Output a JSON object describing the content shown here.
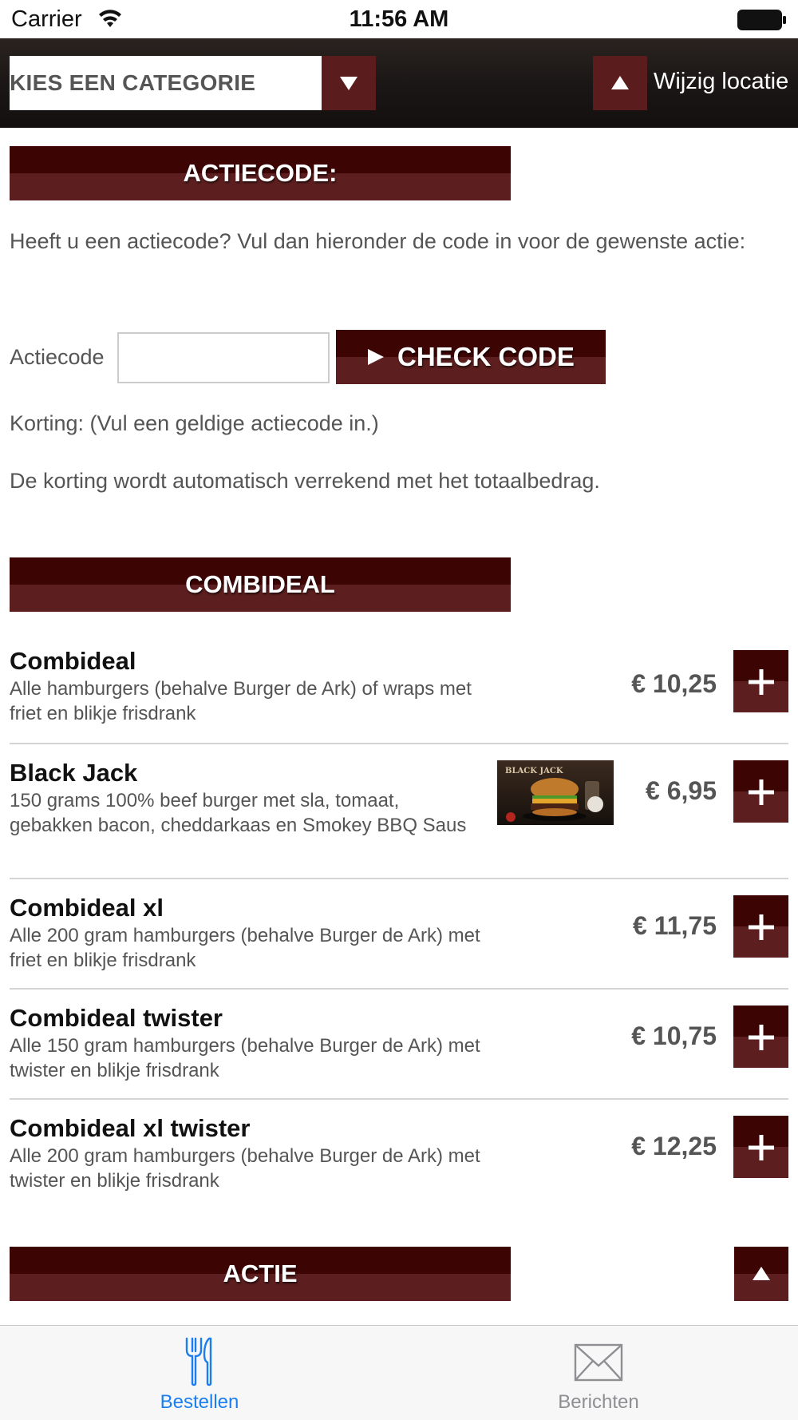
{
  "status_bar": {
    "carrier": "Carrier",
    "time": "11:56 AM"
  },
  "nav": {
    "category_select": "KIES EEN CATEGORIE",
    "location_button": "Wijzig locatie"
  },
  "promo": {
    "header": "ACTIECODE:",
    "intro": "Heeft u een actiecode? Vul dan hieronder de code in voor de gewenste actie:",
    "code_label": "Actiecode",
    "code_value": "",
    "check_button": "CHECK CODE",
    "discount_text": "Korting: (Vul een geldige actiecode in.)",
    "info_text": "De korting wordt automatisch verrekend met het totaalbedrag."
  },
  "combideal": {
    "header": "COMBIDEAL",
    "products": [
      {
        "name": "Combideal",
        "desc": "Alle hamburgers (behalve Burger de Ark) of wraps met friet en blikje frisdrank",
        "price": "€ 10,25"
      },
      {
        "name": "Black Jack",
        "desc": "150 grams 100% beef burger met sla, tomaat, gebakken bacon, cheddarkaas en Smokey BBQ Saus",
        "price": "€ 6,95",
        "image_text": "BLACK JACK"
      },
      {
        "name": "Combideal xl",
        "desc": "Alle 200 gram hamburgers (behalve Burger de Ark) met friet en blikje frisdrank",
        "price": "€ 11,75"
      },
      {
        "name": "Combideal twister",
        "desc": "Alle 150 gram hamburgers (behalve Burger de Ark) met twister en blikje frisdrank",
        "price": "€ 10,75"
      },
      {
        "name": "Combideal xl twister",
        "desc": "Alle 200 gram hamburgers (behalve Burger de Ark) met twister en blikje frisdrank",
        "price": "€ 12,25"
      }
    ]
  },
  "actie": {
    "header": "ACTIE"
  },
  "tabbar": {
    "tabs": [
      {
        "label": "Bestellen",
        "icon": "fork-knife-icon",
        "active": true
      },
      {
        "label": "Berichten",
        "icon": "envelope-icon",
        "active": false
      }
    ]
  },
  "colors": {
    "brand_dark": "#3d0404",
    "brand": "#5c1e1e",
    "tab_active": "#1a7ef0",
    "tab_inactive": "#8e8e93"
  }
}
